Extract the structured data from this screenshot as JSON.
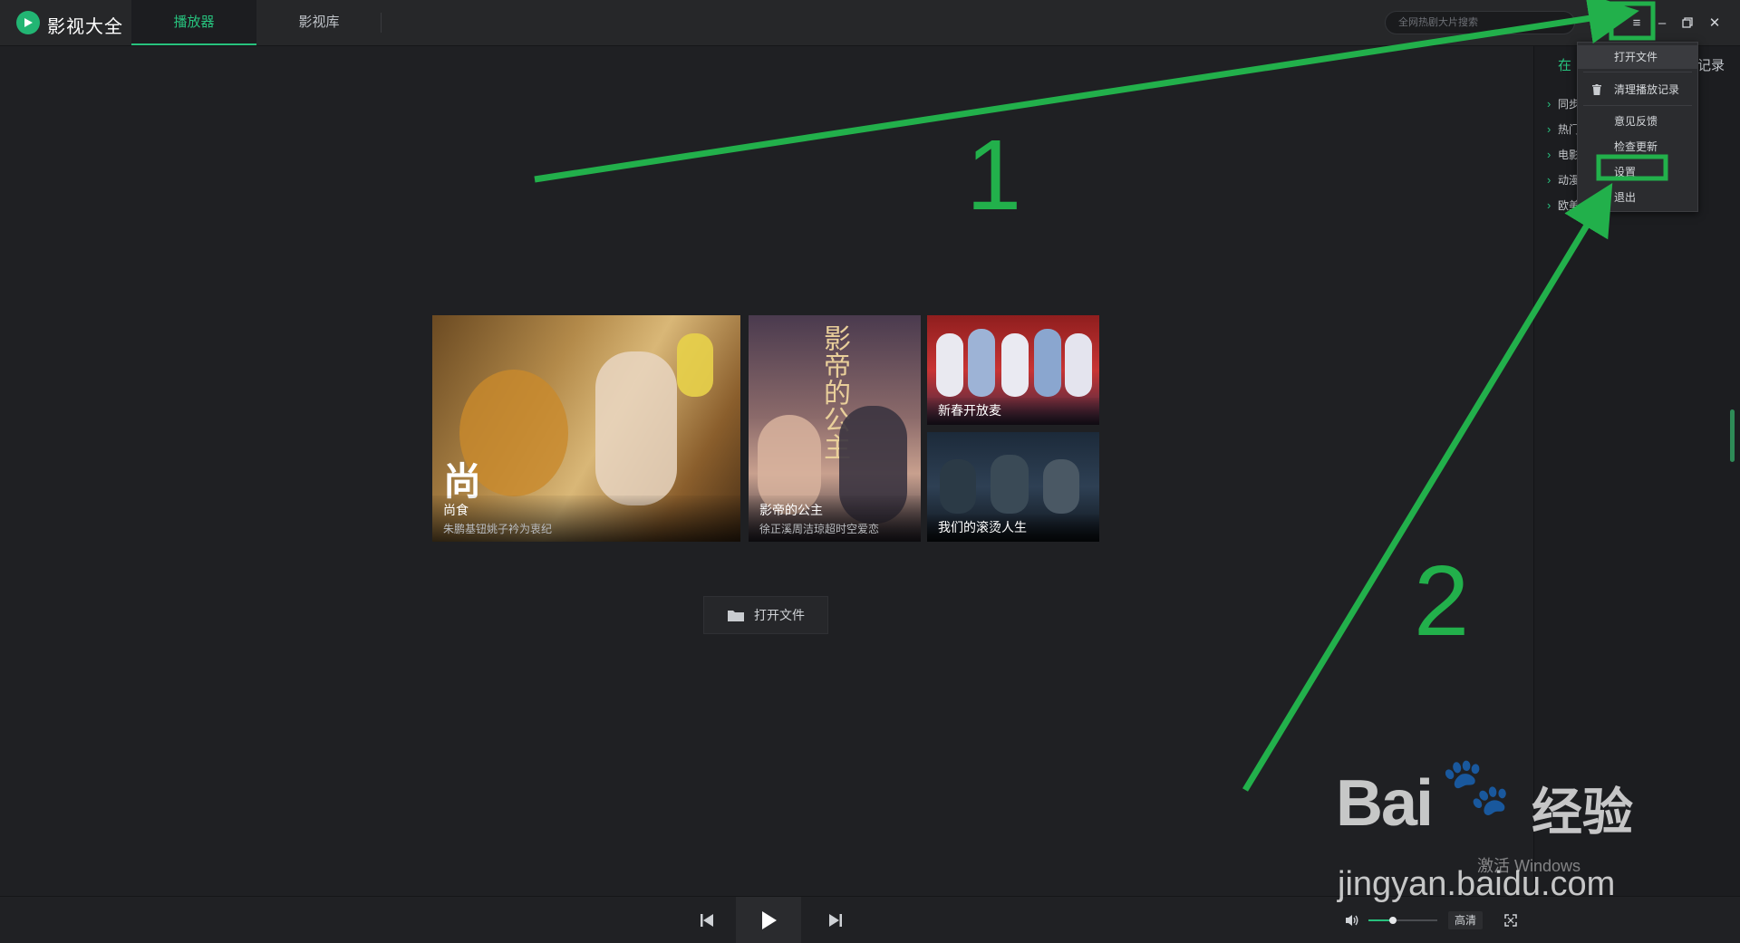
{
  "app": {
    "title": "影视大全"
  },
  "tabs": [
    {
      "label": "播放器"
    },
    {
      "label": "影视库"
    }
  ],
  "search": {
    "placeholder": "全网热剧大片搜索"
  },
  "right_panel": {
    "tab_left": "在",
    "tab_right": "记录",
    "items": [
      {
        "label": "同步"
      },
      {
        "label": "热门"
      },
      {
        "label": "电影"
      },
      {
        "label": "动漫"
      },
      {
        "label": "欧美"
      }
    ]
  },
  "menu": {
    "items": [
      {
        "label": "打开文件"
      },
      {
        "label": "清理播放记录"
      },
      {
        "label": "意见反馈"
      },
      {
        "label": "检查更新"
      },
      {
        "label": "设置"
      },
      {
        "label": "退出"
      }
    ]
  },
  "posters": [
    {
      "title": "尚食",
      "subtitle": "朱鹏基钮姚子衿为衷纪",
      "glyph": "尚"
    },
    {
      "title": "影帝的公主",
      "subtitle": "徐正溪周洁琼超时空爱恋",
      "art_title": "影帝的公主"
    },
    {
      "title": "新春开放麦"
    },
    {
      "title": "我们的滚烫人生"
    }
  ],
  "open_file_button": {
    "label": "打开文件"
  },
  "player": {
    "quality": "高清",
    "volume_percent": 35
  },
  "annotations": {
    "step1": "1",
    "step2": "2",
    "color": "#22b04b"
  },
  "watermark": {
    "brand": "Bai",
    "brand_cn": "经验",
    "url": "jingyan.baidu.com",
    "activate": "激活 Windows"
  }
}
